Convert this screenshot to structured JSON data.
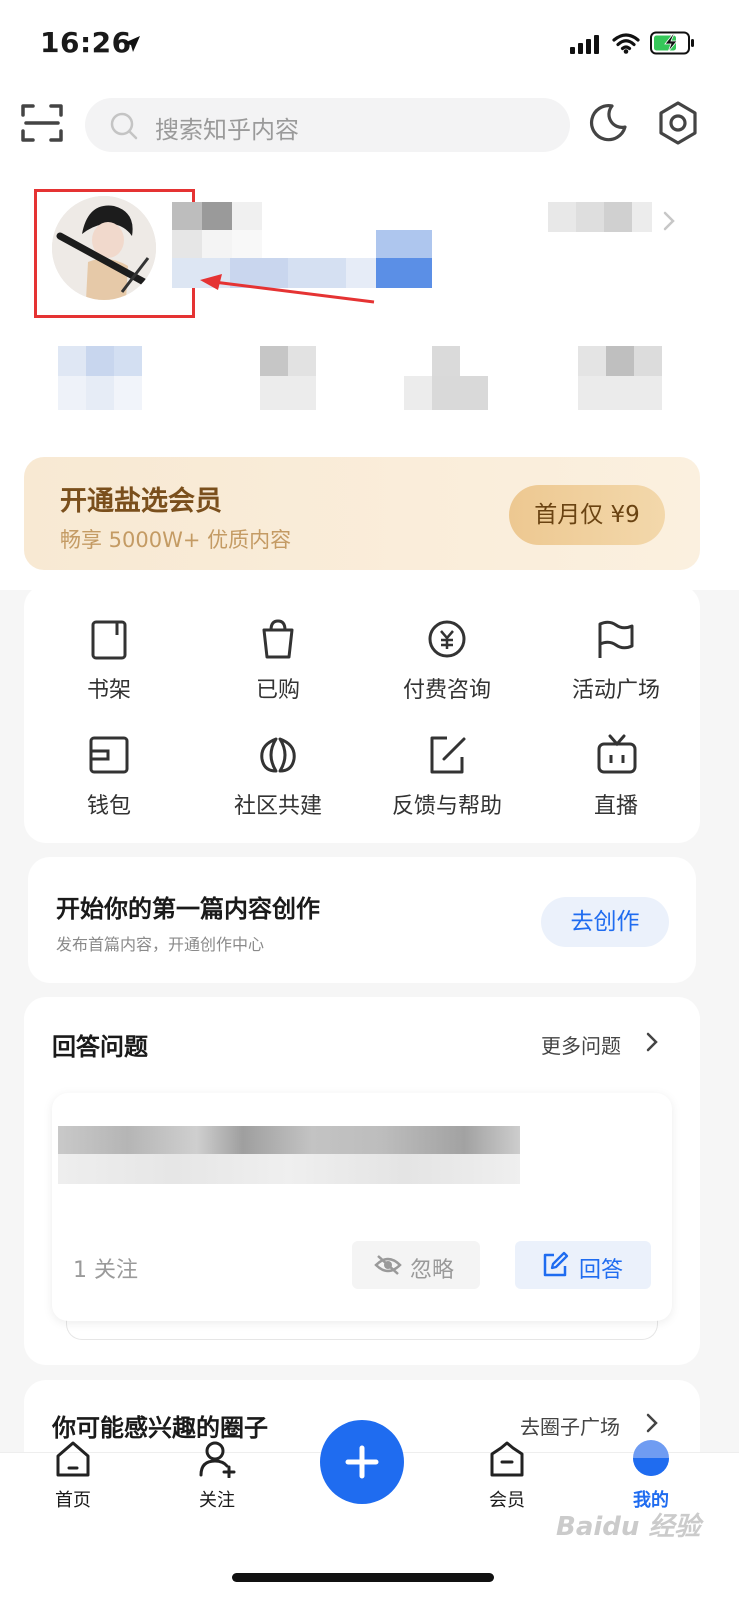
{
  "status_bar": {
    "time": "16:26"
  },
  "header": {
    "search_placeholder": "搜索知乎内容"
  },
  "vip_banner": {
    "title": "开通盐选会员",
    "subtitle": "畅享 5000W+ 优质内容",
    "button": "首月仅 ¥9"
  },
  "grid": {
    "items": [
      {
        "label": "书架",
        "icon": "bookshelf-icon"
      },
      {
        "label": "已购",
        "icon": "shopping-bag-icon"
      },
      {
        "label": "付费咨询",
        "icon": "paid-consult-icon"
      },
      {
        "label": "活动广场",
        "icon": "flag-icon"
      },
      {
        "label": "钱包",
        "icon": "wallet-icon"
      },
      {
        "label": "社区共建",
        "icon": "community-icon"
      },
      {
        "label": "反馈与帮助",
        "icon": "edit-feedback-icon"
      },
      {
        "label": "直播",
        "icon": "tv-icon"
      }
    ]
  },
  "create_card": {
    "title": "开始你的第一篇内容创作",
    "subtitle": "发布首篇内容，开通创作中心",
    "button": "去创作"
  },
  "answer_card": {
    "title": "回答问题",
    "more": "更多问题",
    "followers": "1 关注",
    "ignore": "忽略",
    "answer": "回答"
  },
  "circles": {
    "title": "你可能感兴趣的圈子",
    "more": "去圈子广场"
  },
  "bottom_nav": {
    "home": "首页",
    "follow": "关注",
    "member": "会员",
    "mine": "我的"
  },
  "watermark": "Baidu 经验",
  "colors": {
    "accent": "#1f6cf0",
    "vip_text": "#8a5a20",
    "highlight_box": "#e53333"
  }
}
